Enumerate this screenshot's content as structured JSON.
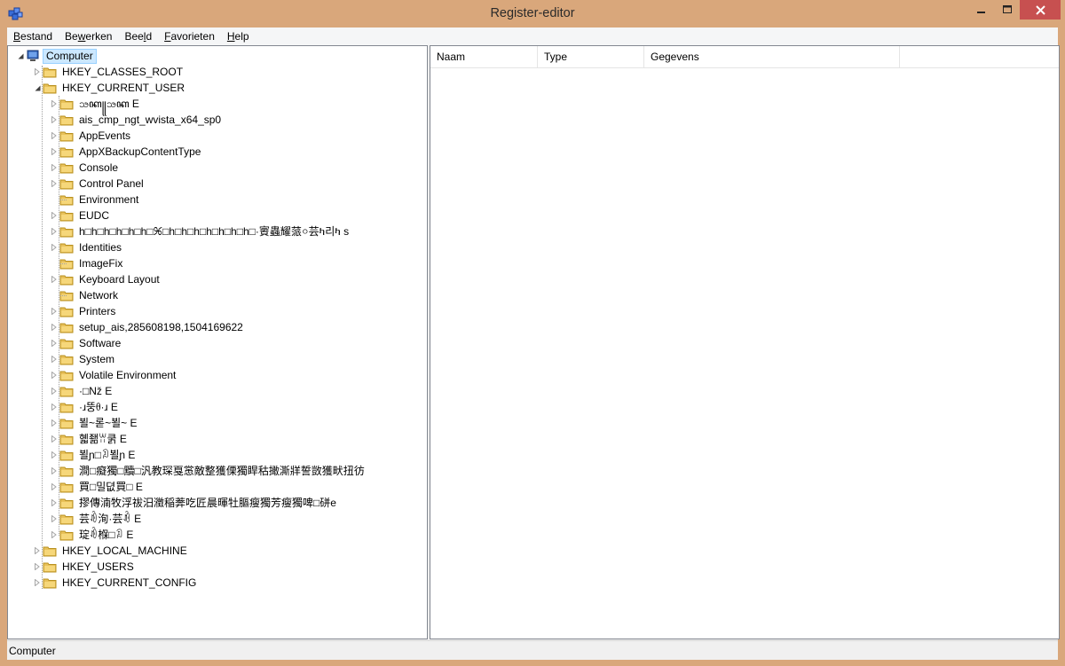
{
  "window": {
    "title": "Register-editor"
  },
  "menu": [
    {
      "label": "Bestand",
      "accel": "B",
      "rest": "estand"
    },
    {
      "label": "Bewerken",
      "pre": "Be",
      "accel": "w",
      "rest": "erken"
    },
    {
      "label": "Beeld",
      "pre": "Bee",
      "accel": "l",
      "rest": "d"
    },
    {
      "label": "Favorieten",
      "accel": "F",
      "rest": "avorieten"
    },
    {
      "label": "Help",
      "accel": "H",
      "rest": "elp"
    }
  ],
  "tree": {
    "root": "Computer",
    "hives": [
      {
        "label": "HKEY_CLASSES_ROOT",
        "expanded": false
      },
      {
        "label": "HKEY_CURRENT_USER",
        "expanded": true
      },
      {
        "label": "HKEY_LOCAL_MACHINE",
        "expanded": false
      },
      {
        "label": "HKEY_USERS",
        "expanded": false
      },
      {
        "label": "HKEY_CURRENT_CONFIG",
        "expanded": false
      }
    ],
    "hkcu_children": [
      {
        "label": "ꧢꦏ꧋ꧢꦏ  E",
        "arrow": true
      },
      {
        "label": "ais_cmp_ngt_wvista_x64_sp0",
        "arrow": true
      },
      {
        "label": "AppEvents",
        "arrow": true
      },
      {
        "label": "AppXBackupContentType",
        "arrow": true
      },
      {
        "label": "Console",
        "arrow": true
      },
      {
        "label": "Control Panel",
        "arrow": true
      },
      {
        "label": "Environment",
        "arrow": false
      },
      {
        "label": "EUDC",
        "arrow": true
      },
      {
        "label": "h□h□h□h□h□h□ꕑ□h□h□h□h□h□h□h□·賨蟲耀蒎০芸ካ리ካ  s",
        "arrow": true
      },
      {
        "label": "Identities",
        "arrow": true
      },
      {
        "label": "ImageFix",
        "arrow": false
      },
      {
        "label": "Keyboard Layout",
        "arrow": true
      },
      {
        "label": "Network",
        "arrow": false
      },
      {
        "label": "Printers",
        "arrow": true
      },
      {
        "label": "setup_ais,285608198,1504169622",
        "arrow": true
      },
      {
        "label": "Software",
        "arrow": true
      },
      {
        "label": "System",
        "arrow": true
      },
      {
        "label": "Volatile Environment",
        "arrow": true
      },
      {
        "label": "·□Nž  E",
        "arrow": true
      },
      {
        "label": "·ɹ뚱ᦲ·ɹ  E",
        "arrow": true
      },
      {
        "label": "뵐~롣~뵐~  E",
        "arrow": true
      },
      {
        "label": "혧좲ꀕ쿩  E",
        "arrow": true
      },
      {
        "label": "뵐ɲ□ꀣ뵐ɲ  E",
        "arrow": true
      },
      {
        "label": "澗□癡獨□黷□汎教琛戛㦂敵整獲傈獨睅秙撖澌牂誓敳獲畎扭彷",
        "arrow": true
      },
      {
        "label": "買□밀뎞買□  E",
        "arrow": true
      },
      {
        "label": "摎傳湳牧浮祓汨瀓稲莾吃匠晨暉牡膒瘦獨芳瘦獨啤□硑e",
        "arrow": true
      },
      {
        "label": "芸ꀐ洵·芸ꀐ  E",
        "arrow": true
      },
      {
        "label": "琔ꀐ椺□ꀣ  E",
        "arrow": true
      }
    ]
  },
  "list": {
    "columns": [
      "Naam",
      "Type",
      "Gegevens"
    ]
  },
  "status": "Computer",
  "colors": {
    "frame": "#d9a77b",
    "close": "#c75050",
    "selection": "#cce8ff",
    "folder": "#e8c15a"
  }
}
